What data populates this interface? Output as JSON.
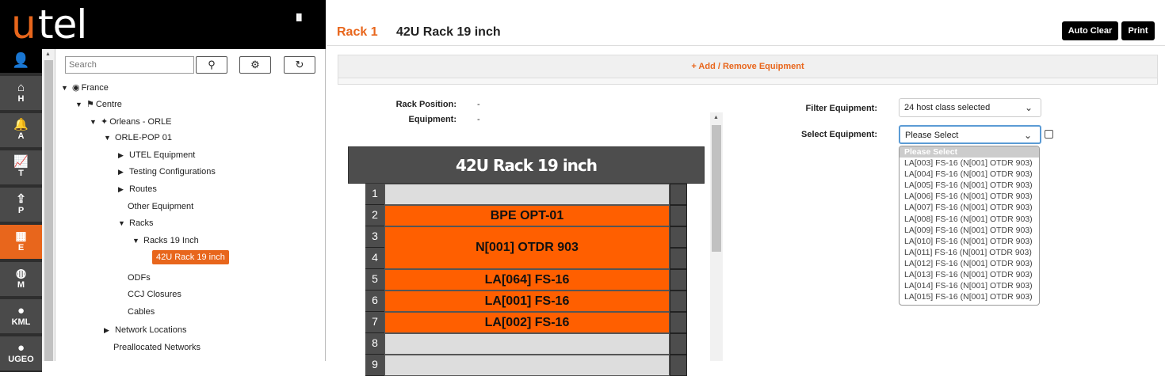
{
  "brand": {
    "letter_u": "u",
    "letters_tel": "tel",
    "menu_icon": "III",
    "accent": "#e8661c"
  },
  "iconbar": [
    {
      "icon": "user-icon",
      "glyph": "👤",
      "label": ""
    },
    {
      "icon": "home-icon",
      "glyph": "⌂",
      "label": "H"
    },
    {
      "icon": "bell-icon",
      "glyph": "🔔",
      "label": "A"
    },
    {
      "icon": "chart-icon",
      "glyph": "📈",
      "label": "T"
    },
    {
      "icon": "share-icon",
      "glyph": "⇪",
      "label": "P"
    },
    {
      "icon": "chip-icon",
      "glyph": "▦",
      "label": "E"
    },
    {
      "icon": "globe-icon",
      "glyph": "◍",
      "label": "M"
    },
    {
      "icon": "pin-icon",
      "glyph": "●",
      "label": "KML"
    },
    {
      "icon": "pin-icon",
      "glyph": "●",
      "label": "UGEO"
    }
  ],
  "tree": {
    "search_placeholder": "Search",
    "nodes": [
      {
        "arrow": "▼",
        "icon": "◉",
        "label": "France"
      },
      {
        "arrow": "▼",
        "icon": "⚑",
        "label": "Centre"
      },
      {
        "arrow": "▼",
        "icon": "✦",
        "label": "Orleans - ORLE"
      },
      {
        "arrow": "▼",
        "icon": "",
        "label": "ORLE-POP 01"
      },
      {
        "arrow": "▶",
        "icon": "",
        "label": "UTEL Equipment"
      },
      {
        "arrow": "▶",
        "icon": "",
        "label": "Testing Configurations"
      },
      {
        "arrow": "▶",
        "icon": "",
        "label": "Routes"
      },
      {
        "arrow": "",
        "icon": "",
        "label": "Other Equipment"
      },
      {
        "arrow": "▼",
        "icon": "",
        "label": "Racks"
      },
      {
        "arrow": "▼",
        "icon": "",
        "label": "Racks 19 Inch"
      },
      {
        "arrow": "",
        "icon": "",
        "label": "42U Rack 19 inch"
      },
      {
        "arrow": "",
        "icon": "",
        "label": "ODFs"
      },
      {
        "arrow": "",
        "icon": "",
        "label": "CCJ Closures"
      },
      {
        "arrow": "",
        "icon": "",
        "label": "Cables"
      },
      {
        "arrow": "▶",
        "icon": "",
        "label": "Network Locations"
      },
      {
        "arrow": "",
        "icon": "",
        "label": "Preallocated Networks"
      }
    ]
  },
  "header": {
    "rack_label": "Rack 1",
    "rack_name": "42U Rack 19 inch",
    "auto_clear": "Auto Clear",
    "print": "Print"
  },
  "add_remove": "+ Add / Remove Equipment",
  "info": {
    "rack_position_label": "Rack Position:",
    "rack_position_value": "-",
    "equipment_label": "Equipment:",
    "equipment_value": "-"
  },
  "filter": {
    "label": "Filter Equipment:",
    "value": "24 host class selected"
  },
  "select": {
    "label": "Select Equipment:",
    "value": "Please Select",
    "options": [
      "Please Select",
      "LA[003] FS-16 (N[001] OTDR 903)",
      "LA[004] FS-16 (N[001] OTDR 903)",
      "LA[005] FS-16 (N[001] OTDR 903)",
      "LA[006] FS-16 (N[001] OTDR 903)",
      "LA[007] FS-16 (N[001] OTDR 903)",
      "LA[008] FS-16 (N[001] OTDR 903)",
      "LA[009] FS-16 (N[001] OTDR 903)",
      "LA[010] FS-16 (N[001] OTDR 903)",
      "LA[011] FS-16 (N[001] OTDR 903)",
      "LA[012] FS-16 (N[001] OTDR 903)",
      "LA[013] FS-16 (N[001] OTDR 903)",
      "LA[014] FS-16 (N[001] OTDR 903)",
      "LA[015] FS-16 (N[001] OTDR 903)"
    ]
  },
  "rack": {
    "title": "42U Rack 19 inch",
    "slots": [
      "1",
      "2",
      "3",
      "4",
      "5",
      "6",
      "7",
      "8",
      "9"
    ],
    "equipment": [
      {
        "label": "BPE OPT-01",
        "start": 2,
        "units": 1
      },
      {
        "label": "N[001] OTDR 903",
        "start": 3,
        "units": 2
      },
      {
        "label": "LA[064] FS-16",
        "start": 5,
        "units": 1
      },
      {
        "label": "LA[001] FS-16",
        "start": 6,
        "units": 1
      },
      {
        "label": "LA[002] FS-16",
        "start": 7,
        "units": 1
      }
    ]
  }
}
